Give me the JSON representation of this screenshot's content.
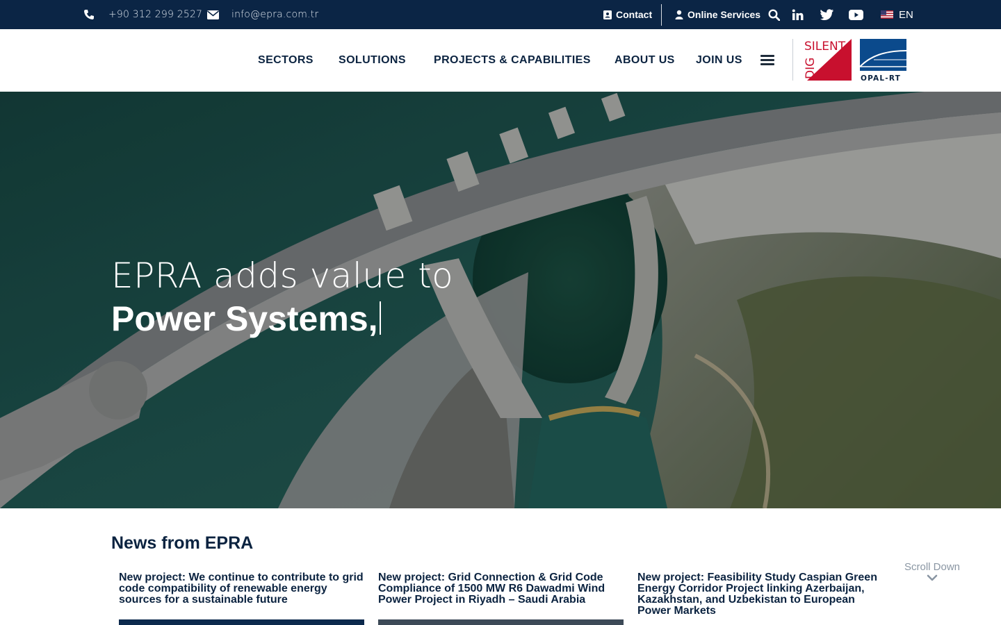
{
  "topbar": {
    "phone": "+90 312 299 2527",
    "email": "info@epra.com.tr",
    "contact_label": "Contact",
    "online_services_label": "Online Services",
    "language": "EN",
    "icons": [
      "phone-icon",
      "envelope-icon",
      "contact-card-icon",
      "user-icon",
      "search-icon",
      "linkedin-icon",
      "twitter-icon",
      "youtube-icon",
      "us-flag-icon"
    ]
  },
  "nav": {
    "items": [
      {
        "label": "SECTORS"
      },
      {
        "label": "SOLUTIONS"
      },
      {
        "label": "PROJECTS & CAPABILITIES"
      },
      {
        "label": "ABOUT US"
      },
      {
        "label": "JOIN US"
      }
    ]
  },
  "partners": {
    "digsilent": {
      "top": "SILENT",
      "side": "DIG"
    },
    "opalrt": {
      "text": "OPAL-RT"
    }
  },
  "hero": {
    "line1": "EPRA adds value to",
    "line2": "Power Systems,"
  },
  "news": {
    "title": "News from EPRA",
    "items": [
      {
        "title": "New project: We continue to contribute to grid code compatibility of renewable energy sources for a sustainable future"
      },
      {
        "title": "New project: Grid Connection & Grid Code Compliance of 1500 MW R6 Dawadmi Wind Power Project in Riyadh – Saudi Arabia"
      },
      {
        "title": "New project: Feasibility Study Caspian Green Energy Corridor Project linking Azerbaijan, Kazakhstan, and Uzbekistan to European Power Markets"
      }
    ],
    "scroll_label": "Scroll Down"
  },
  "colors": {
    "topbar_bg": "#0b2545",
    "text_dark": "#0b2340",
    "digsilent_red": "#c8102e",
    "opal_blue": "#0b4a8c"
  }
}
